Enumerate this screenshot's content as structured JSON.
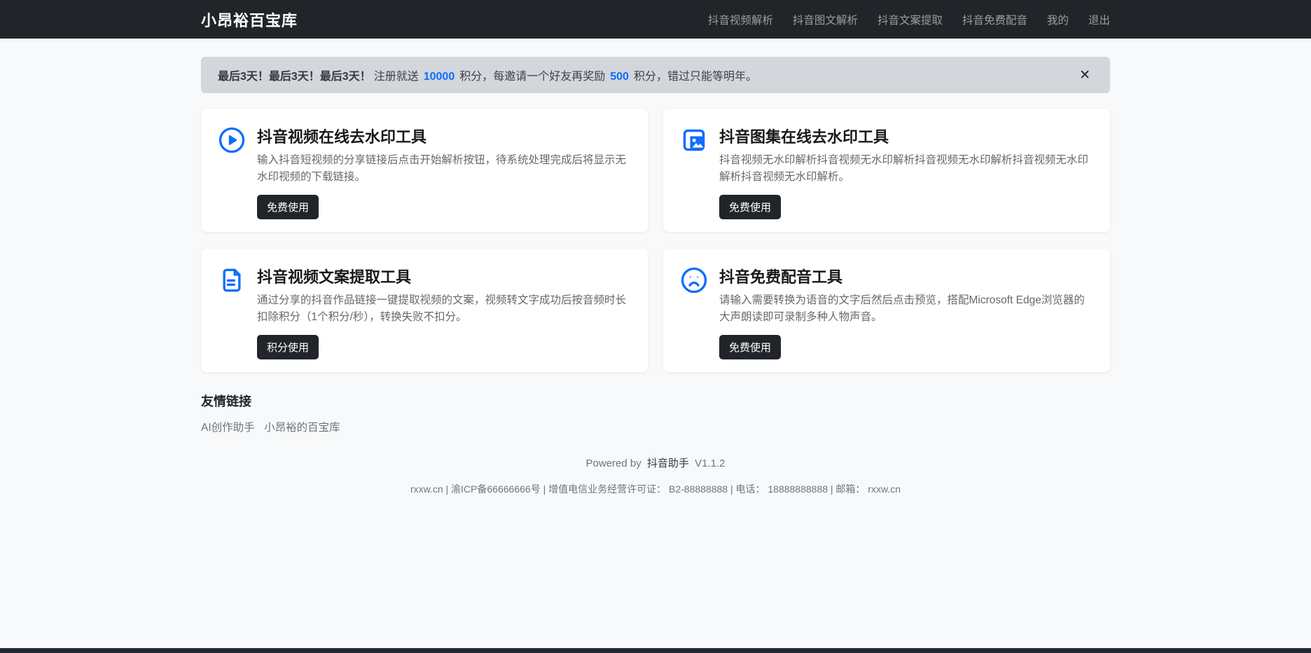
{
  "navbar": {
    "brand": "小昂裕百宝库",
    "items": [
      {
        "label": "抖音视频解析"
      },
      {
        "label": "抖音图文解析"
      },
      {
        "label": "抖音文案提取"
      },
      {
        "label": "抖音免费配音"
      },
      {
        "label": "我的"
      },
      {
        "label": "退出"
      }
    ]
  },
  "banner": {
    "bold": "最后3天！最后3天！最后3天！",
    "text_register": "注册就送",
    "points_register": "10000",
    "text_mid": "积分，每邀请一个好友再奖励",
    "points_invite": "500",
    "text_end": "积分，错过只能等明年。",
    "close": "✕"
  },
  "cards": [
    {
      "icon": "play-circle-icon",
      "title": "抖音视频在线去水印工具",
      "description": "输入抖音短视频的分享链接后点击开始解析按钮，待系统处理完成后将显示无水印视频的下载链接。",
      "button": "免费使用"
    },
    {
      "icon": "images-icon",
      "title": "抖音图集在线去水印工具",
      "description": "抖音视频无水印解析抖音视频无水印解析抖音视频无水印解析抖音视频无水印解析抖音视频无水印解析。",
      "button": "免费使用"
    },
    {
      "icon": "document-text-icon",
      "title": "抖音视频文案提取工具",
      "description": "通过分享的抖音作品链接一键提取视频的文案，视频转文字成功后按音频时长扣除积分（1个积分/秒），转换失败不扣分。",
      "button": "积分使用"
    },
    {
      "icon": "frown-face-icon",
      "title": "抖音免费配音工具",
      "description": "请输入需要转换为语音的文字后然后点击预览，搭配Microsoft Edge浏览器的大声朗读即可录制多种人物声音。",
      "button": "免费使用"
    }
  ],
  "friends": {
    "title": "友情链接",
    "links": [
      {
        "label": "AI创作助手"
      },
      {
        "label": "小昂裕的百宝库"
      }
    ]
  },
  "footer": {
    "powered_prefix": "Powered by",
    "powered_link": "抖音助手",
    "version": "V1.1.2",
    "info": "rxxw.cn | 渝ICP备66666666号 | 增值电信业务经营许可证： B2-88888888 | 电话： 18888888888 | 邮箱： rxxw.cn"
  },
  "colors": {
    "accent_blue": "#0d6efd",
    "navbar_bg": "#212529",
    "banner_bg": "#d3d6db",
    "button_bg": "#212529",
    "page_bg": "#f8f9fa"
  }
}
